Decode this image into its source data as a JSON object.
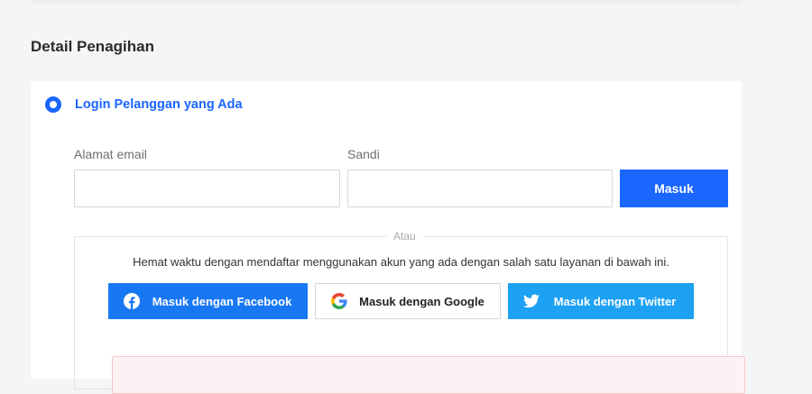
{
  "section": {
    "title": "Detail Penagihan"
  },
  "login_option": {
    "label": "Login Pelanggan yang Ada",
    "selected": true
  },
  "form": {
    "email_label": "Alamat email",
    "email_value": "",
    "password_label": "Sandi",
    "password_value": "",
    "submit_label": "Masuk"
  },
  "social": {
    "divider_label": "Atau",
    "hint": "Hemat waktu dengan mendaftar menggunakan akun yang ada dengan salah satu layanan di bawah ini.",
    "buttons": [
      {
        "label": "Masuk dengan Facebook",
        "icon": "facebook-icon",
        "color": "#1877f2"
      },
      {
        "label": "Masuk dengan Google",
        "icon": "google-icon",
        "color": "#ffffff"
      },
      {
        "label": "Masuk dengan Twitter",
        "icon": "twitter-icon",
        "color": "#1da1f2"
      }
    ]
  },
  "colors": {
    "accent": "#1a66ff",
    "background": "#f4f5f7"
  }
}
